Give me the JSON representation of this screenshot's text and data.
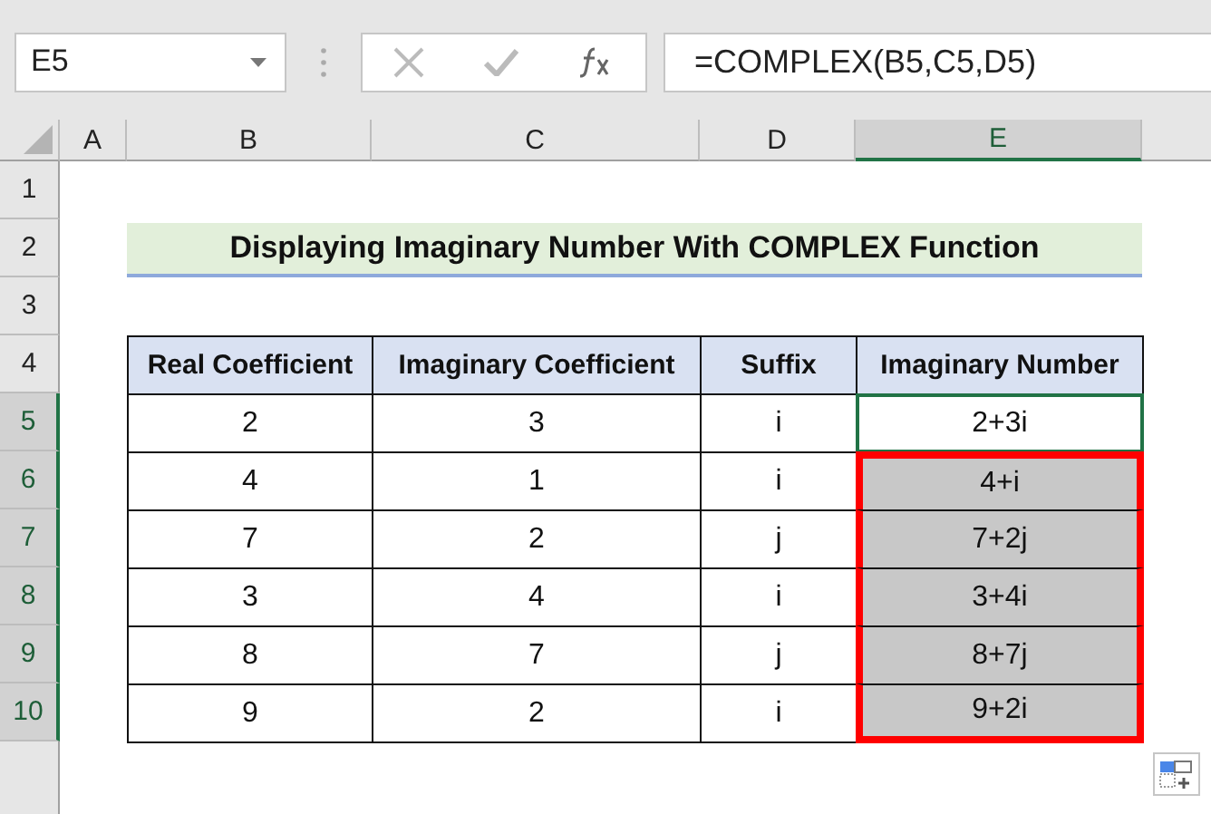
{
  "name_box": {
    "value": "E5"
  },
  "formula_bar": {
    "formula": "=COMPLEX(B5,C5,D5)"
  },
  "columns": [
    {
      "label": "A",
      "selected": false
    },
    {
      "label": "B",
      "selected": false
    },
    {
      "label": "C",
      "selected": false
    },
    {
      "label": "D",
      "selected": false
    },
    {
      "label": "E",
      "selected": true
    }
  ],
  "rows": [
    {
      "label": "1",
      "selected": false
    },
    {
      "label": "2",
      "selected": false
    },
    {
      "label": "3",
      "selected": false
    },
    {
      "label": "4",
      "selected": false
    },
    {
      "label": "5",
      "selected": true
    },
    {
      "label": "6",
      "selected": true
    },
    {
      "label": "7",
      "selected": true
    },
    {
      "label": "8",
      "selected": true
    },
    {
      "label": "9",
      "selected": true
    },
    {
      "label": "10",
      "selected": true
    }
  ],
  "title": "Displaying Imaginary Number With COMPLEX Function",
  "table": {
    "columns": [
      "Real Coefficient",
      "Imaginary Coefficient",
      "Suffix",
      "Imaginary Number"
    ],
    "rows": [
      {
        "cells": [
          "2",
          "3",
          "i",
          "2+3i"
        ],
        "active": true,
        "highlighted": false
      },
      {
        "cells": [
          "4",
          "1",
          "i",
          "4+i"
        ],
        "active": false,
        "highlighted": true
      },
      {
        "cells": [
          "7",
          "2",
          "j",
          "7+2j"
        ],
        "active": false,
        "highlighted": true
      },
      {
        "cells": [
          "3",
          "4",
          "i",
          "3+4i"
        ],
        "active": false,
        "highlighted": true
      },
      {
        "cells": [
          "8",
          "7",
          "j",
          "8+7j"
        ],
        "active": false,
        "highlighted": true
      },
      {
        "cells": [
          "9",
          "2",
          "i",
          "9+2i"
        ],
        "active": false,
        "highlighted": true
      }
    ]
  }
}
